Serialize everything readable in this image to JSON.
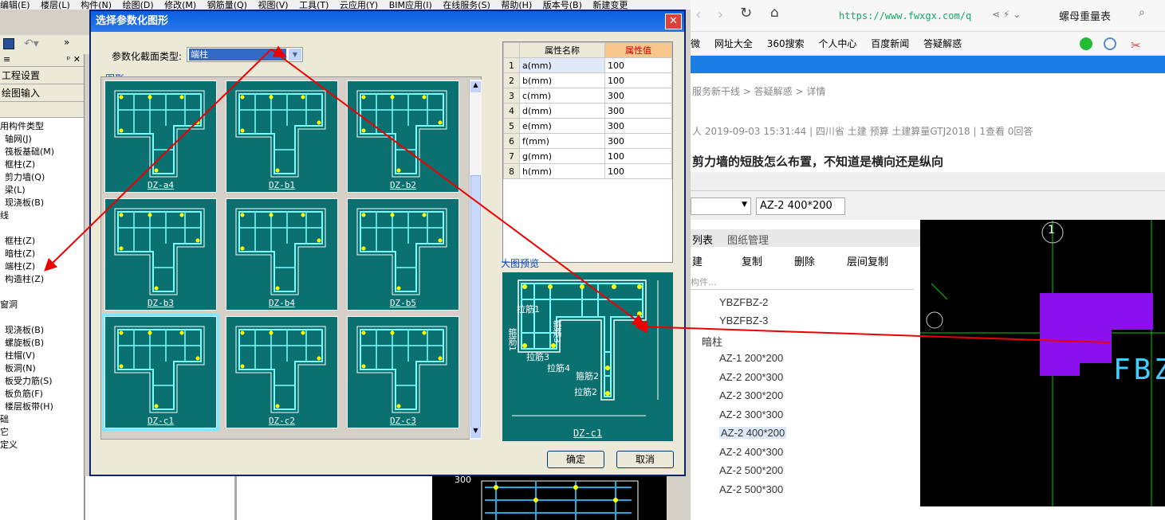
{
  "app": {
    "menu": [
      "编辑(E)",
      "楼层(L)",
      "构件(N)",
      "绘图(D)",
      "修改(M)",
      "钢筋量(Q)",
      "视图(V)",
      "工具(T)",
      "云应用(Y)",
      "BIM应用(I)",
      "在线服务(S)",
      "帮助(H)",
      "版本号(B)",
      "新建变更"
    ],
    "panel_buttons": [
      "工程设置",
      "绘图输入"
    ],
    "tree": [
      "用构件类型",
      "轴网(J)",
      "筏板基础(M)",
      "框柱(Z)",
      "剪力墙(Q)",
      "梁(L)",
      "现浇板(B)",
      "线",
      "框柱(Z)",
      "暗柱(Z)",
      "端柱(Z)",
      "构造柱(Z)",
      "窗洞",
      "现浇板(B)",
      "螺旋板(B)",
      "柱帽(V)",
      "板洞(N)",
      "板受力筋(S)",
      "板负筋(F)",
      "楼层板带(H)",
      "础",
      "它",
      "定义"
    ],
    "cad_dim": "300"
  },
  "dialog": {
    "title": "选择参数化图形",
    "section_type_label": "参数化截面类型:",
    "section_type_value": "端柱",
    "shapes_label": "图形",
    "thumbs": [
      "DZ-a4",
      "DZ-b1",
      "DZ-b2",
      "DZ-b3",
      "DZ-b4",
      "DZ-b5",
      "DZ-c1",
      "DZ-c2",
      "DZ-c3"
    ],
    "prop_headers": {
      "name": "属性名称",
      "value": "属性值"
    },
    "props": [
      {
        "n": "1",
        "name": "a(mm)",
        "value": "100"
      },
      {
        "n": "2",
        "name": "b(mm)",
        "value": "100"
      },
      {
        "n": "3",
        "name": "c(mm)",
        "value": "300"
      },
      {
        "n": "4",
        "name": "d(mm)",
        "value": "300"
      },
      {
        "n": "5",
        "name": "e(mm)",
        "value": "300"
      },
      {
        "n": "6",
        "name": "f(mm)",
        "value": "300"
      },
      {
        "n": "7",
        "name": "g(mm)",
        "value": "100"
      },
      {
        "n": "8",
        "name": "h(mm)",
        "value": "100"
      }
    ],
    "preview_label": "大图预览",
    "preview_name": "DZ-c1",
    "preview_labels": [
      "拉筋1",
      "箍筋1",
      "箍筋3",
      "拉筋3",
      "拉筋4",
      "箍筋2",
      "拉筋2"
    ],
    "ok": "确定",
    "cancel": "取消"
  },
  "browser": {
    "url": "https://www.fwxgx.com/q",
    "search": "螺母重量表",
    "favorites": [
      "微",
      "网址大全",
      "360搜索",
      "个人中心",
      "百度新闻",
      "答疑解惑"
    ],
    "breadcrumb": "服务新干线 > 答疑解惑 > 详情",
    "meta": "人   2019-09-03 15:31:44   |   四川省  土建  预算  土建算量GTJ2018   |   1查看  0回答",
    "question": "剪力墙的短肢怎么布置，不知道是横向还是纵向",
    "shot": {
      "select_value": "AZ-2 400*200",
      "tabs": [
        "列表",
        "图纸管理"
      ],
      "tools": [
        "建",
        "复制",
        "删除",
        "层间复制"
      ],
      "search_placeholder": "构件...",
      "items": [
        "YBZFBZ-2",
        "YBZFBZ-3",
        "暗柱",
        "AZ-1 200*200",
        "AZ-2 200*300",
        "AZ-2 300*200",
        "AZ-2 300*300",
        "AZ-2 400*200",
        "AZ-2 400*300",
        "AZ-2 500*200",
        "AZ-2 500*300"
      ],
      "cad_axis": "1",
      "cad_text": "FBZ"
    }
  }
}
